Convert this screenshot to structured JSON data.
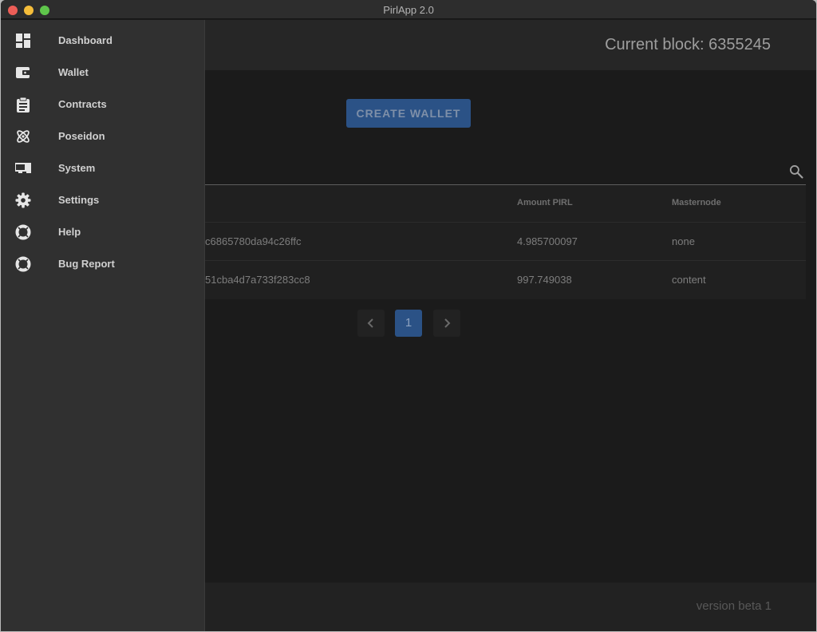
{
  "window": {
    "title": "PirlApp 2.0"
  },
  "header": {
    "current_block": "Current block: 6355245"
  },
  "actions": {
    "create_wallet": "CREATE WALLET"
  },
  "table": {
    "columns": [
      "Amount PIRL",
      "Masternode"
    ],
    "rows": [
      {
        "address": "c6865780da94c26ffc",
        "amount": "4.985700097",
        "masternode": "none"
      },
      {
        "address": "51cba4d7a733f283cc8",
        "amount": "997.749038",
        "masternode": "content"
      }
    ]
  },
  "pagination": {
    "current_page": "1"
  },
  "footer": {
    "version": "version beta 1"
  },
  "sidebar": {
    "items": [
      {
        "label": "Dashboard",
        "icon": "dashboard-icon"
      },
      {
        "label": "Wallet",
        "icon": "wallet-icon"
      },
      {
        "label": "Contracts",
        "icon": "clipboard-icon"
      },
      {
        "label": "Poseidon",
        "icon": "atom-icon"
      },
      {
        "label": "System",
        "icon": "devices-icon"
      },
      {
        "label": "Settings",
        "icon": "gear-icon"
      },
      {
        "label": "Help",
        "icon": "lifebuoy-icon"
      },
      {
        "label": "Bug Report",
        "icon": "lifebuoy-icon"
      }
    ]
  },
  "colors": {
    "accent": "#2b5286",
    "background": "#1b1b1b",
    "drawer": "#303030"
  }
}
